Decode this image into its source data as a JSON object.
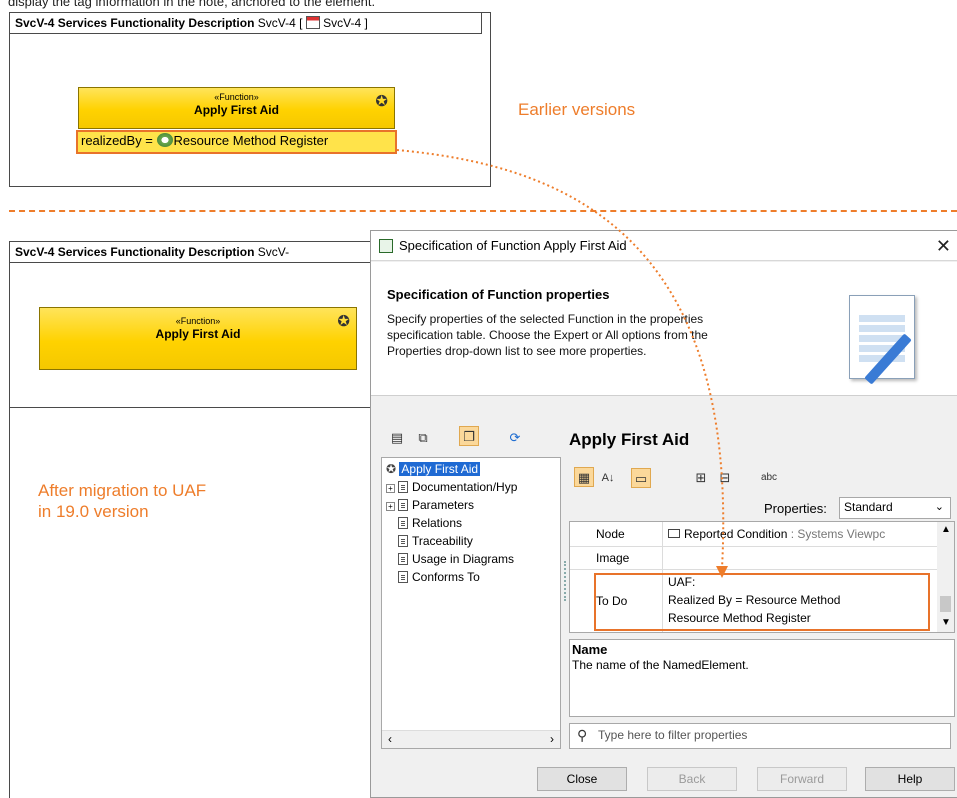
{
  "caption": "display the tag information in the note, anchored to the element.",
  "top_diagram": {
    "frame_kind": "SvcV-4 Services Functionality Description",
    "frame_ref_prefix": "SvcV-4 [",
    "frame_ref_name": "SvcV-4 ]",
    "block_stereotype": "«Function»",
    "block_name": "Apply First Aid",
    "tag_text": "realizedBy = ",
    "tag_value": "Resource Method Register"
  },
  "label_earlier": "Earlier versions",
  "bottom_diagram": {
    "frame_kind": "SvcV-4 Services Functionality Description",
    "frame_ref_prefix": "SvcV-",
    "block_stereotype": "«Function»",
    "block_name": "Apply First Aid"
  },
  "label_after_line1": "After migration to UAF",
  "label_after_line2": "in 19.0 version",
  "dialog": {
    "title": "Specification of Function Apply First Aid",
    "close_glyph": "✕",
    "header_title": "Specification of Function properties",
    "header_desc_1": "Specify properties of the selected Function in the properties",
    "header_desc_2": "specification table. Choose the Expert or All options from the",
    "header_desc_3": "Properties drop-down list to see more properties.",
    "element_title": "Apply First Aid",
    "tree": [
      {
        "label": "Apply First Aid"
      },
      {
        "label": "Documentation/Hyp"
      },
      {
        "label": "Parameters"
      },
      {
        "label": "Relations"
      },
      {
        "label": "Traceability"
      },
      {
        "label": "Usage in Diagrams"
      },
      {
        "label": "Conforms To"
      }
    ],
    "properties_label": "Properties:",
    "properties_value": "Standard",
    "rows": {
      "node_name": "Node",
      "node_value": "Reported Condition",
      "node_value_suffix": " : Systems Viewpc",
      "image_name": "Image",
      "todo_name": "To Do",
      "todo_line1": "UAF:",
      "todo_line2": "Realized By = Resource Method",
      "todo_line3": "Resource Method Register"
    },
    "desc_name": "Name",
    "desc_text": "The name of the NamedElement.",
    "filter_placeholder": "Type here to filter properties",
    "buttons": {
      "close": "Close",
      "back": "Back",
      "forward": "Forward",
      "help": "Help"
    }
  },
  "colors": {
    "orange": "#ee7d2b",
    "function_fill": "#ffd200",
    "highlight": "#e8732a"
  }
}
